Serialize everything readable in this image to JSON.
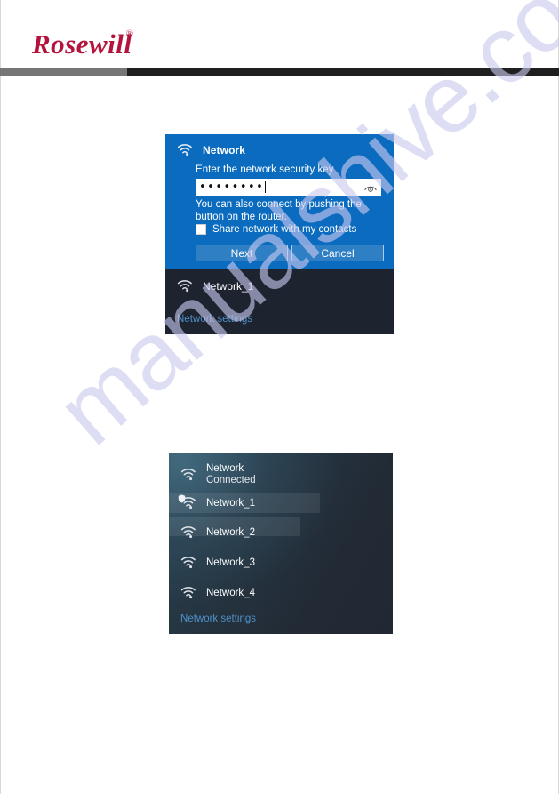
{
  "header": {
    "logo_text": "Rosewill",
    "logo_registered": "®",
    "rule_gray_color": "#767676",
    "rule_dark_color": "#1f1f1f",
    "logo_color": "#b4143c"
  },
  "watermark": {
    "text": "manualshive.com"
  },
  "security_dialog": {
    "icon": "wifi-icon",
    "title": "Network",
    "prompt": "Enter the network security key",
    "password_value": "••••••••",
    "password_placeholder": "",
    "reveal_icon": "eye-icon",
    "hint": "You can also connect by pushing the button on the router.",
    "share_checkbox_label": "Share network with my contacts",
    "share_checkbox_checked": false,
    "next_label": "Next",
    "cancel_label": "Cancel",
    "network_item": {
      "icon": "wifi-icon",
      "name": "Network_1"
    },
    "settings_link": "Network settings",
    "accent_color": "#0b6cbf",
    "button_color": "#2f7fc4",
    "panel_dark_color": "#1d2430",
    "link_color": "#4f8fc6"
  },
  "network_list": {
    "items": [
      {
        "icon": "wifi-icon",
        "name": "Network",
        "status": "Connected",
        "secured": false
      },
      {
        "icon": "wifi-icon",
        "name": "Network_1",
        "status": "",
        "secured": true
      },
      {
        "icon": "wifi-icon",
        "name": "Network_2",
        "status": "",
        "secured": false
      },
      {
        "icon": "wifi-icon",
        "name": "Network_3",
        "status": "",
        "secured": false
      },
      {
        "icon": "wifi-icon",
        "name": "Network_4",
        "status": "",
        "secured": false
      }
    ],
    "settings_link": "Network settings",
    "link_color": "#4f8fc6"
  }
}
